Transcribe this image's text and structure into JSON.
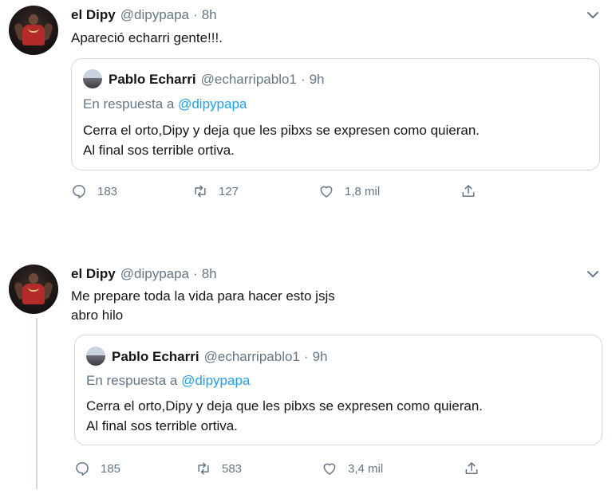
{
  "tweets": [
    {
      "author": {
        "name": "el Dipy",
        "handle": "@dipypapa",
        "time": "8h"
      },
      "text": "Apareció echarri gente!!!.",
      "quoted": {
        "author": {
          "name": "Pablo Echarri",
          "handle": "@echarripablo1",
          "time": "9h"
        },
        "reply_prefix": "En respuesta a",
        "reply_to": "@dipypapa",
        "text": "Cerra el orto,Dipy y deja que les pibxs se expresen como quieran.\nAl final sos terrible ortiva."
      },
      "stats": {
        "replies": "183",
        "retweets": "127",
        "likes": "1,8 mil"
      }
    },
    {
      "author": {
        "name": "el Dipy",
        "handle": "@dipypapa",
        "time": "8h"
      },
      "text": "Me prepare toda la vida para hacer esto jsjs\nabro hilo",
      "quoted": {
        "author": {
          "name": "Pablo Echarri",
          "handle": "@echarripablo1",
          "time": "9h"
        },
        "reply_prefix": "En respuesta a",
        "reply_to": "@dipypapa",
        "text": "Cerra el orto,Dipy y deja que les pibxs se expresen como quieran.\nAl final sos terrible ortiva."
      },
      "stats": {
        "replies": "185",
        "retweets": "583",
        "likes": "3,4 mil"
      }
    }
  ],
  "separator": "·",
  "icons": [
    "chevron-down-icon",
    "reply-icon",
    "retweet-icon",
    "like-icon",
    "share-icon"
  ],
  "colors": {
    "text": "#14171a",
    "muted": "#657786",
    "link": "#1da1f2",
    "border": "#cfd9de"
  }
}
